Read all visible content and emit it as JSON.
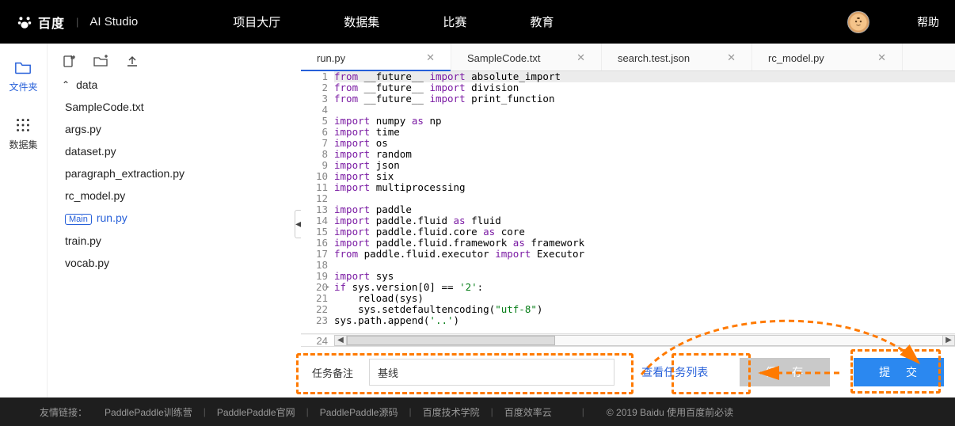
{
  "nav": {
    "logo_cn": "百度",
    "logo_studio": "AI Studio",
    "links": [
      "项目大厅",
      "数据集",
      "比赛",
      "教育"
    ],
    "help": "帮助"
  },
  "leftbar": {
    "files": "文件夹",
    "datasets": "数据集"
  },
  "tree": {
    "folder": "data",
    "files": [
      "SampleCode.txt",
      "args.py",
      "dataset.py",
      "paragraph_extraction.py",
      "rc_model.py",
      "run.py",
      "train.py",
      "vocab.py"
    ],
    "main_badge": "Main",
    "active": "run.py"
  },
  "tabs": [
    "run.py",
    "SampleCode.txt",
    "search.test.json",
    "rc_model.py"
  ],
  "active_tab": "run.py",
  "code": [
    {
      "n": 1,
      "tokens": [
        [
          "kw",
          "from"
        ],
        [
          "",
          ""
        ],
        [
          "",
          "__future__"
        ],
        [
          "",
          ""
        ],
        [
          "kw",
          "import"
        ],
        [
          "",
          ""
        ],
        [
          "",
          "absolute_import"
        ]
      ]
    },
    {
      "n": 2,
      "tokens": [
        [
          "kw",
          "from"
        ],
        [
          "",
          ""
        ],
        [
          "",
          "__future__"
        ],
        [
          "",
          ""
        ],
        [
          "kw",
          "import"
        ],
        [
          "",
          ""
        ],
        [
          "",
          "division"
        ]
      ]
    },
    {
      "n": 3,
      "tokens": [
        [
          "kw",
          "from"
        ],
        [
          "",
          ""
        ],
        [
          "",
          "__future__"
        ],
        [
          "",
          ""
        ],
        [
          "kw",
          "import"
        ],
        [
          "",
          ""
        ],
        [
          "",
          "print_function"
        ]
      ]
    },
    {
      "n": 4,
      "tokens": []
    },
    {
      "n": 5,
      "tokens": [
        [
          "kw",
          "import"
        ],
        [
          "",
          ""
        ],
        [
          "",
          "numpy"
        ],
        [
          "",
          ""
        ],
        [
          "kw",
          "as"
        ],
        [
          "",
          ""
        ],
        [
          "",
          "np"
        ]
      ]
    },
    {
      "n": 6,
      "tokens": [
        [
          "kw",
          "import"
        ],
        [
          "",
          ""
        ],
        [
          "",
          "time"
        ]
      ]
    },
    {
      "n": 7,
      "tokens": [
        [
          "kw",
          "import"
        ],
        [
          "",
          ""
        ],
        [
          "",
          "os"
        ]
      ]
    },
    {
      "n": 8,
      "tokens": [
        [
          "kw",
          "import"
        ],
        [
          "",
          ""
        ],
        [
          "",
          "random"
        ]
      ]
    },
    {
      "n": 9,
      "tokens": [
        [
          "kw",
          "import"
        ],
        [
          "",
          ""
        ],
        [
          "",
          "json"
        ]
      ]
    },
    {
      "n": 10,
      "tokens": [
        [
          "kw",
          "import"
        ],
        [
          "",
          ""
        ],
        [
          "",
          "six"
        ]
      ]
    },
    {
      "n": 11,
      "tokens": [
        [
          "kw",
          "import"
        ],
        [
          "",
          ""
        ],
        [
          "",
          "multiprocessing"
        ]
      ]
    },
    {
      "n": 12,
      "tokens": []
    },
    {
      "n": 13,
      "tokens": [
        [
          "kw",
          "import"
        ],
        [
          "",
          ""
        ],
        [
          "",
          "paddle"
        ]
      ]
    },
    {
      "n": 14,
      "tokens": [
        [
          "kw",
          "import"
        ],
        [
          "",
          ""
        ],
        [
          "",
          "paddle.fluid"
        ],
        [
          "",
          ""
        ],
        [
          "kw",
          "as"
        ],
        [
          "",
          ""
        ],
        [
          "",
          "fluid"
        ]
      ]
    },
    {
      "n": 15,
      "tokens": [
        [
          "kw",
          "import"
        ],
        [
          "",
          ""
        ],
        [
          "",
          "paddle.fluid.core"
        ],
        [
          "",
          ""
        ],
        [
          "kw",
          "as"
        ],
        [
          "",
          ""
        ],
        [
          "",
          "core"
        ]
      ]
    },
    {
      "n": 16,
      "tokens": [
        [
          "kw",
          "import"
        ],
        [
          "",
          ""
        ],
        [
          "",
          "paddle.fluid.framework"
        ],
        [
          "",
          ""
        ],
        [
          "kw",
          "as"
        ],
        [
          "",
          ""
        ],
        [
          "",
          "framework"
        ]
      ]
    },
    {
      "n": 17,
      "tokens": [
        [
          "kw",
          "from"
        ],
        [
          "",
          ""
        ],
        [
          "",
          "paddle.fluid.executor"
        ],
        [
          "",
          ""
        ],
        [
          "kw",
          "import"
        ],
        [
          "",
          ""
        ],
        [
          "",
          "Executor"
        ]
      ]
    },
    {
      "n": 18,
      "tokens": []
    },
    {
      "n": 19,
      "tokens": [
        [
          "kw",
          "import"
        ],
        [
          "",
          ""
        ],
        [
          "",
          "sys"
        ]
      ]
    },
    {
      "n": 20,
      "marker": "▸",
      "tokens": [
        [
          "kw",
          "if"
        ],
        [
          "",
          ""
        ],
        [
          "",
          "sys.version[0]"
        ],
        [
          "",
          ""
        ],
        [
          "",
          "=="
        ],
        [
          "",
          ""
        ],
        [
          "str",
          "'2'"
        ],
        [
          "",
          ":"
        ]
      ]
    },
    {
      "n": 21,
      "tokens": [
        [
          "",
          "    reload(sys)"
        ]
      ]
    },
    {
      "n": 22,
      "tokens": [
        [
          "",
          "    sys.setdefaultencoding("
        ],
        [
          "str",
          "\"utf-8\""
        ],
        [
          "",
          ")"
        ]
      ]
    },
    {
      "n": 23,
      "tokens": [
        [
          "",
          "sys.path.append("
        ],
        [
          "str",
          "'..'"
        ],
        [
          "",
          ")"
        ]
      ]
    },
    {
      "n": 24,
      "tokens": []
    }
  ],
  "bottom": {
    "label": "任务备注",
    "input_value": "基线",
    "view_tasks": "查看任务列表",
    "save": "保 存",
    "submit": "提 交"
  },
  "footer": {
    "label": "友情链接：",
    "links": [
      "PaddlePaddle训练营",
      "PaddlePaddle官网",
      "PaddlePaddle源码",
      "百度技术学院",
      "百度效率云"
    ],
    "copyright": "© 2019 Baidu 使用百度前必读"
  }
}
